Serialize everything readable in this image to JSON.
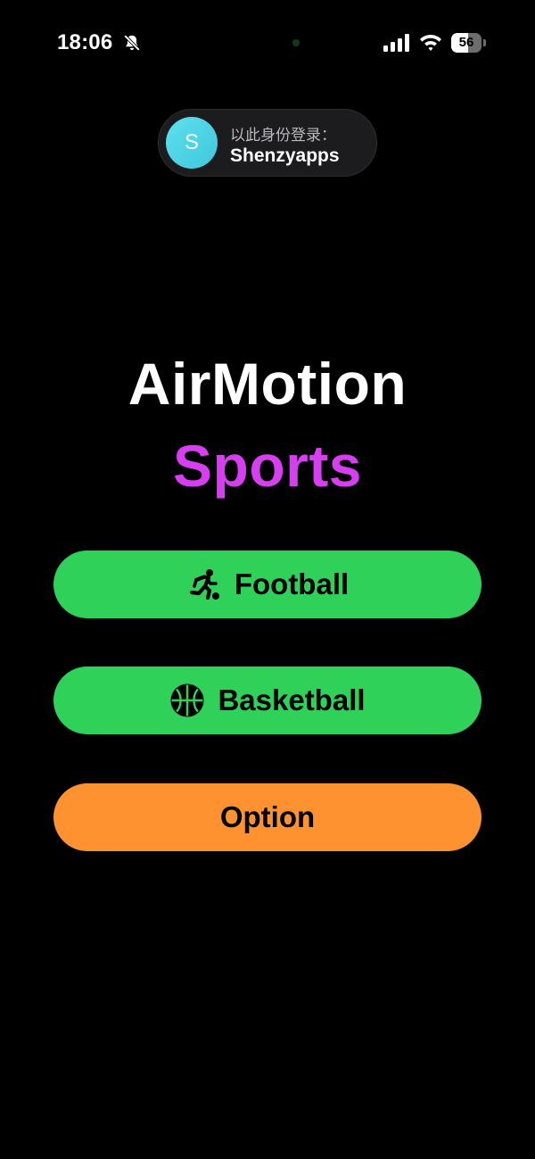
{
  "status_bar": {
    "time": "18:06",
    "battery_level": "56",
    "battery_fraction": 0.56,
    "icons": {
      "silent": "bell-off-icon",
      "signal": "cellular-signal-icon",
      "wifi": "wifi-icon",
      "battery": "battery-icon"
    }
  },
  "login": {
    "avatar_initial": "S",
    "caption": "以此身份登录：",
    "username": "Shenzyapps",
    "avatar_color": "#4fd6e6"
  },
  "title": {
    "main": "AirMotion",
    "sub": "Sports",
    "sub_color": "#d63ff0"
  },
  "menu": {
    "football": {
      "label": "Football",
      "icon": "running-figure-icon",
      "color": "#30d158"
    },
    "basketball": {
      "label": "Basketball",
      "icon": "basketball-icon",
      "color": "#30d158"
    },
    "option": {
      "label": "Option",
      "color": "#ff9230"
    }
  }
}
